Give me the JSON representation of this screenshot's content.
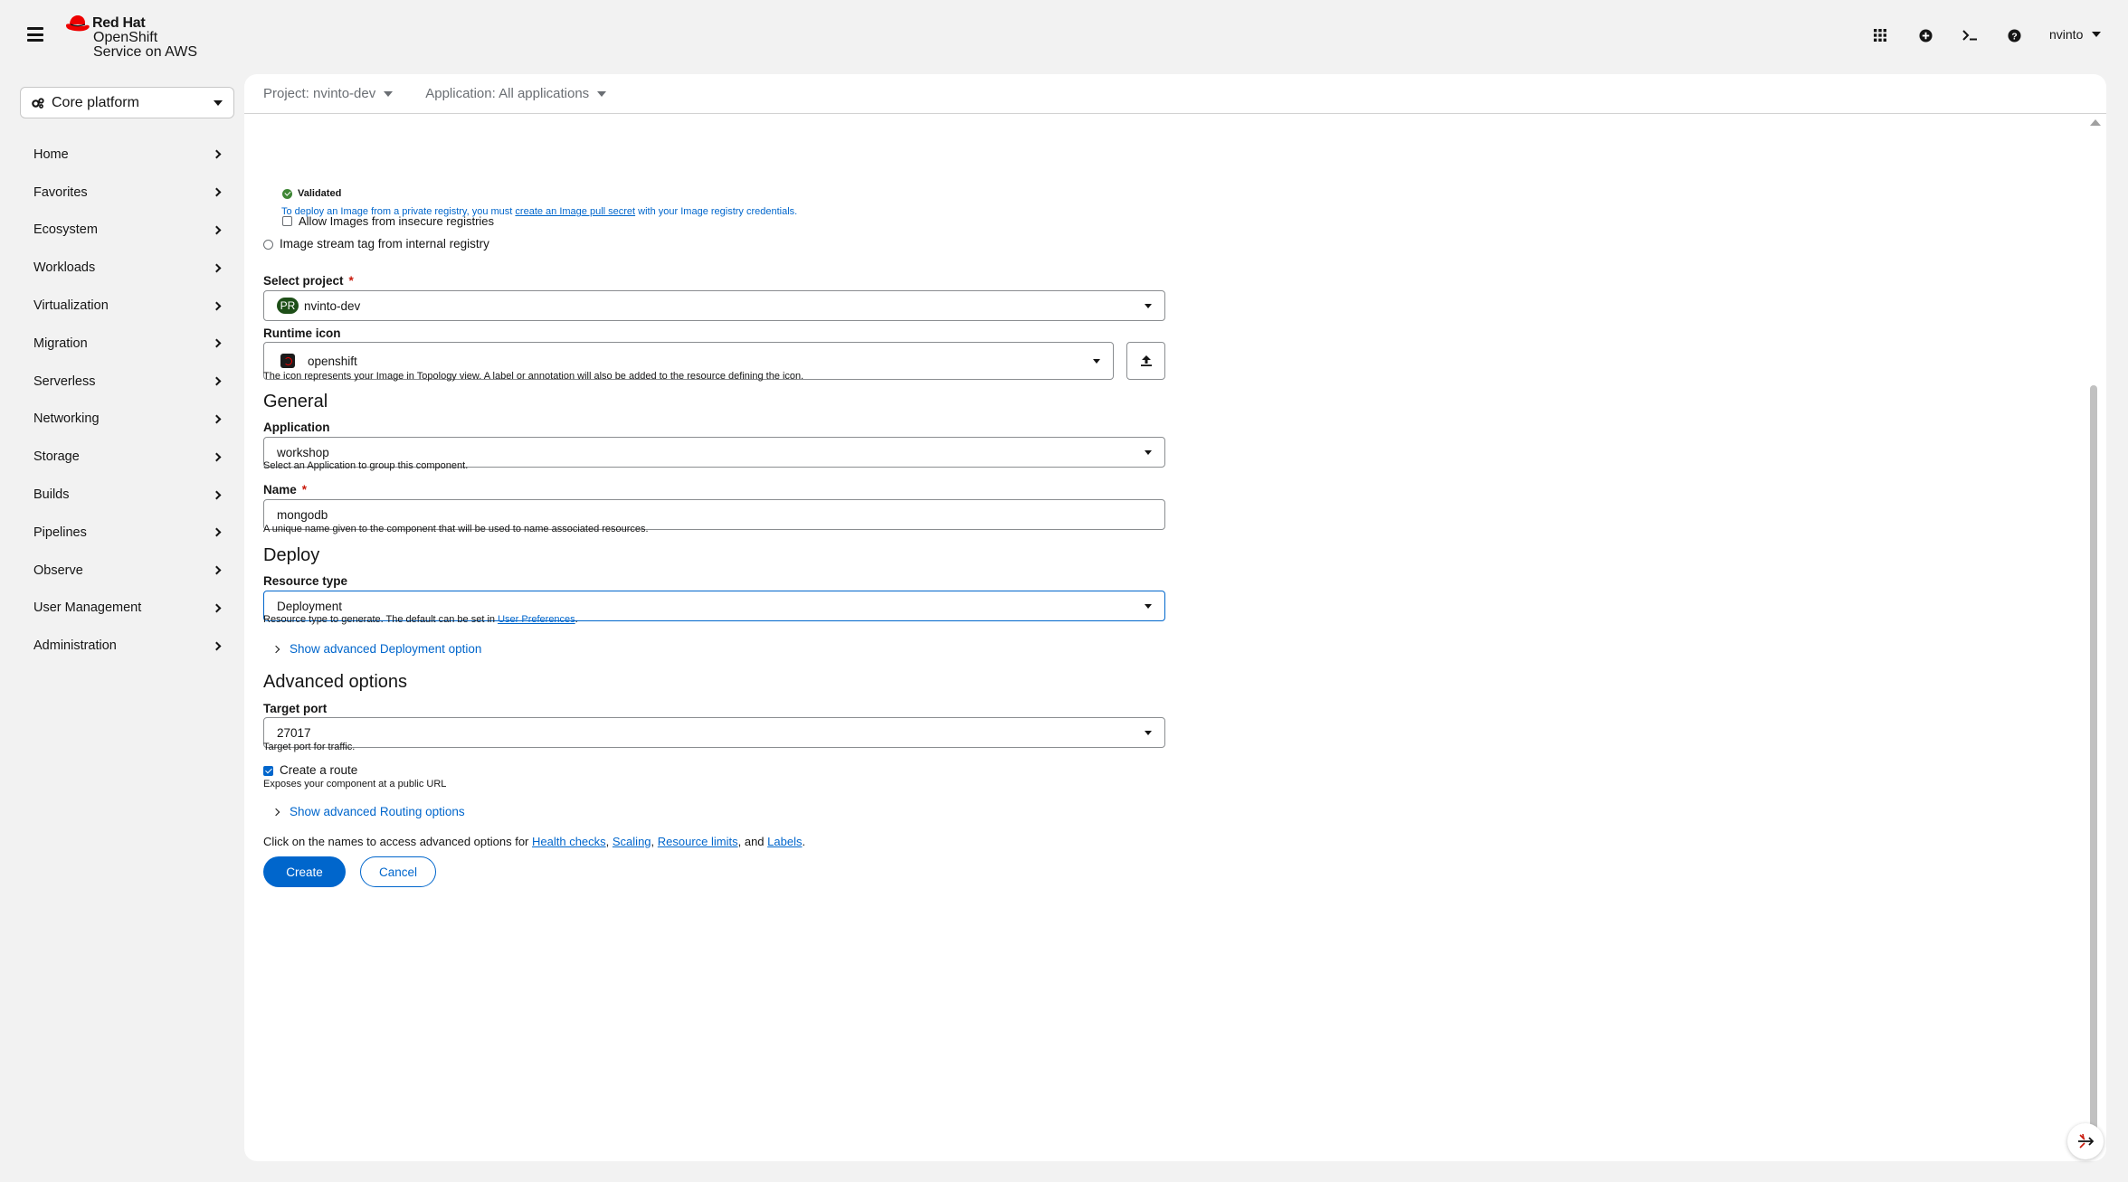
{
  "masthead": {
    "brand_line1": "Red Hat",
    "brand_line2": "OpenShift",
    "brand_line3": "Service on AWS",
    "user": "nvinto",
    "icons": [
      "grid-icon",
      "plus-circle-icon",
      "terminal-icon",
      "help-icon"
    ]
  },
  "sidebar": {
    "perspective": "Core platform",
    "items": [
      {
        "label": "Home"
      },
      {
        "label": "Favorites"
      },
      {
        "label": "Ecosystem"
      },
      {
        "label": "Workloads"
      },
      {
        "label": "Virtualization"
      },
      {
        "label": "Migration"
      },
      {
        "label": "Serverless"
      },
      {
        "label": "Networking"
      },
      {
        "label": "Storage"
      },
      {
        "label": "Builds"
      },
      {
        "label": "Pipelines"
      },
      {
        "label": "Observe"
      },
      {
        "label": "User Management"
      },
      {
        "label": "Administration"
      }
    ]
  },
  "context_bar": {
    "project": "Project: nvinto-dev",
    "application": "Application: All applications"
  },
  "form": {
    "validated": "Validated",
    "pull_secret_prefix": "To deploy an Image from a private registry, you must ",
    "pull_secret_link": "create an Image pull secret",
    "pull_secret_suffix": " with your Image registry credentials.",
    "insecure_label": "Allow Images from insecure registries",
    "imagestream_label": "Image stream tag from internal registry",
    "select_project_label": "Select project",
    "required_mark": "*",
    "project_badge": "PR",
    "project_value": "nvinto-dev",
    "runtime_icon_label": "Runtime icon",
    "runtime_icon_value": "openshift",
    "runtime_icon_help": "The icon represents your Image in Topology view. A label or annotation will also be added to the resource defining the icon.",
    "general_heading": "General",
    "application_label": "Application",
    "application_value": "workshop",
    "application_help": "Select an Application to group this component.",
    "name_label": "Name",
    "name_value": "mongodb",
    "name_help": "A unique name given to the component that will be used to name associated resources.",
    "deploy_heading": "Deploy",
    "resource_type_label": "Resource type",
    "resource_type_value": "Deployment",
    "resource_help_prefix": "Resource type to generate. The default can be set in ",
    "resource_help_link": "User Preferences",
    "resource_help_suffix": ".",
    "advanced_deployment": "Show advanced Deployment option",
    "advanced_heading": "Advanced options",
    "target_port_label": "Target port",
    "target_port_value": "27017",
    "target_port_help": "Target port for traffic.",
    "create_route_label": "Create a route",
    "create_route_checked": true,
    "create_route_help": "Exposes your component at a public URL",
    "advanced_routing": "Show advanced Routing options",
    "footer_prefix": "Click on the names to access advanced options for ",
    "footer_link_health": "Health checks",
    "footer_sep1": ", ",
    "footer_link_scaling": "Scaling",
    "footer_sep2": ", ",
    "footer_link_limits": "Resource limits",
    "footer_sep3": ", and ",
    "footer_link_labels": "Labels",
    "footer_suffix": ".",
    "create_button": "Create",
    "cancel_button": "Cancel"
  },
  "colors": {
    "primary": "#0066cc",
    "redhat_red": "#ee0000",
    "success": "#3e8635"
  }
}
